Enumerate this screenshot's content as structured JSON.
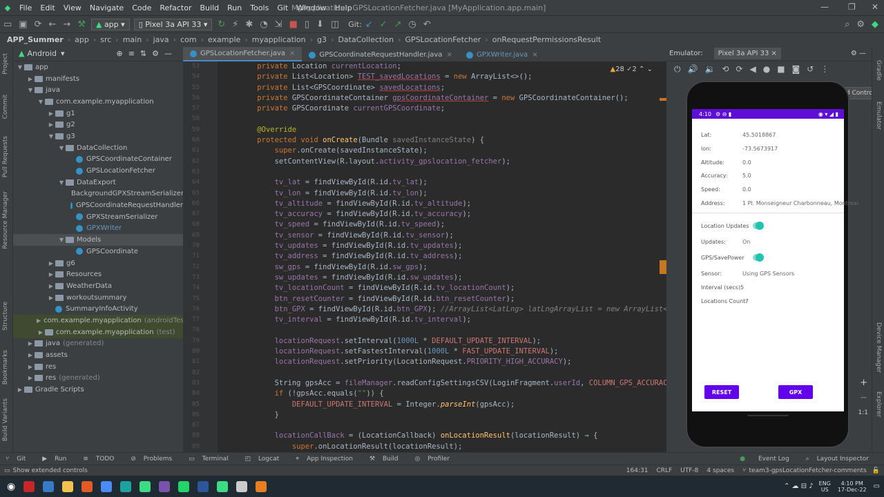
{
  "menu": {
    "items": [
      "File",
      "Edit",
      "View",
      "Navigate",
      "Code",
      "Refactor",
      "Build",
      "Run",
      "Tools",
      "Git",
      "Window",
      "Help"
    ],
    "title": "MyApplication - GPSLocationFetcher.java [MyApplication.app.main]"
  },
  "toolbar": {
    "run_config": "app",
    "device": "Pixel 3a API 33",
    "git_label": "Git:"
  },
  "breadcrumbs": [
    "APP_Summer",
    "app",
    "src",
    "main",
    "java",
    "com",
    "example",
    "myapplication",
    "g3",
    "DataCollection",
    "GPSLocationFetcher",
    "onRequestPermissionsResult"
  ],
  "project": {
    "view": "Android",
    "tree": [
      {
        "label": "app",
        "depth": 0,
        "kind": "folder",
        "open": true
      },
      {
        "label": "manifests",
        "depth": 1,
        "kind": "folder"
      },
      {
        "label": "java",
        "depth": 1,
        "kind": "folder",
        "open": true
      },
      {
        "label": "com.example.myapplication",
        "depth": 2,
        "kind": "folder",
        "open": true
      },
      {
        "label": "g1",
        "depth": 3,
        "kind": "folder"
      },
      {
        "label": "g2",
        "depth": 3,
        "kind": "folder"
      },
      {
        "label": "g3",
        "depth": 3,
        "kind": "folder",
        "open": true
      },
      {
        "label": "DataCollection",
        "depth": 4,
        "kind": "folder",
        "open": true
      },
      {
        "label": "GPSCoordinateContainer",
        "depth": 5,
        "kind": "class"
      },
      {
        "label": "GPSLocationFetcher",
        "depth": 5,
        "kind": "class"
      },
      {
        "label": "DataExport",
        "depth": 4,
        "kind": "folder",
        "open": true
      },
      {
        "label": "BackgroundGPXStreamSerializer",
        "depth": 5,
        "kind": "class"
      },
      {
        "label": "GPSCoordinateRequestHandler",
        "depth": 5,
        "kind": "class"
      },
      {
        "label": "GPXStreamSerializer",
        "depth": 5,
        "kind": "class"
      },
      {
        "label": "GPXWriter",
        "depth": 5,
        "kind": "class",
        "muted": true
      },
      {
        "label": "Models",
        "depth": 4,
        "kind": "folder",
        "open": true,
        "sel": true
      },
      {
        "label": "GPSCoordinate",
        "depth": 5,
        "kind": "class"
      },
      {
        "label": "g6",
        "depth": 3,
        "kind": "folder"
      },
      {
        "label": "Resources",
        "depth": 3,
        "kind": "folder"
      },
      {
        "label": "WeatherData",
        "depth": 3,
        "kind": "folder"
      },
      {
        "label": "workoutsummary",
        "depth": 3,
        "kind": "folder"
      },
      {
        "label": "SummaryInfoActivity",
        "depth": 3,
        "kind": "class"
      },
      {
        "label": "com.example.myapplication",
        "suffix": "(androidTest)",
        "depth": 2,
        "kind": "folder",
        "hl": true
      },
      {
        "label": "com.example.myapplication",
        "suffix": "(test)",
        "depth": 2,
        "kind": "folder",
        "hl": true
      },
      {
        "label": "java",
        "suffix": "(generated)",
        "depth": 1,
        "kind": "folder"
      },
      {
        "label": "assets",
        "depth": 1,
        "kind": "folder"
      },
      {
        "label": "res",
        "depth": 1,
        "kind": "folder"
      },
      {
        "label": "res",
        "suffix": "(generated)",
        "depth": 1,
        "kind": "folder"
      },
      {
        "label": "Gradle Scripts",
        "depth": 0,
        "kind": "folder"
      }
    ]
  },
  "editor": {
    "tabs": [
      "GPSLocationFetcher.java",
      "GPSCoordinateRequestHandler.java",
      "GPXWriter.java"
    ],
    "warnings": "28",
    "errors": "2",
    "lines": [
      "53",
      "54",
      "55",
      "56",
      "57",
      "58",
      "59",
      "60",
      "61",
      "62",
      "63",
      "64",
      "65",
      "66",
      "67",
      "68",
      "69",
      "70",
      "71",
      "72",
      "73",
      "74",
      "75",
      "76",
      "77",
      "78",
      "79",
      "80",
      "81",
      "82",
      "83",
      "84",
      "85",
      "86",
      "87",
      "88",
      "89"
    ]
  },
  "emulator": {
    "label": "Emulator:",
    "device": "Pixel 3a API 33",
    "tooltip": "Extended Controls",
    "zoom": "1:1"
  },
  "phone": {
    "time": "4:10",
    "fields": [
      {
        "label": "Lat:",
        "value": "45.5018867"
      },
      {
        "label": "lon:",
        "value": "-73.5673917"
      },
      {
        "label": "Altitude:",
        "value": "0.0"
      },
      {
        "label": "Accuracy:",
        "value": "5.0"
      },
      {
        "label": "Speed:",
        "value": "0.0"
      },
      {
        "label": "Address:",
        "value": "1 Pl. Monseigneur Charbonneau, Montreal"
      }
    ],
    "location_updates": "Location Updates",
    "updates_label": "Updates:",
    "updates_value": "On",
    "gps_label": "GPS/SavePower",
    "sensor_label": "Sensor:",
    "sensor_value": "Using GPS Sensors",
    "interval_label": "Interval (secs):",
    "interval_value": "5",
    "count_label": "Locations Count:",
    "count_value": "7",
    "reset": "RESET",
    "gpx": "GPX"
  },
  "bottom": {
    "tabs": [
      "Git",
      "Run",
      "TODO",
      "Problems",
      "Terminal",
      "Logcat",
      "App Inspection",
      "Build",
      "Profiler"
    ],
    "right": [
      "Event Log",
      "Layout Inspector"
    ]
  },
  "status": {
    "message": "Show extended controls",
    "position": "164:31",
    "eol": "CRLF",
    "encoding": "UTF-8",
    "indent": "4 spaces",
    "branch": "team3-gpsLocationFetcher-comments"
  },
  "taskbar": {
    "lang": "ENG",
    "region": "US",
    "time": "4:10 PM",
    "date": "17-Dec-22"
  }
}
